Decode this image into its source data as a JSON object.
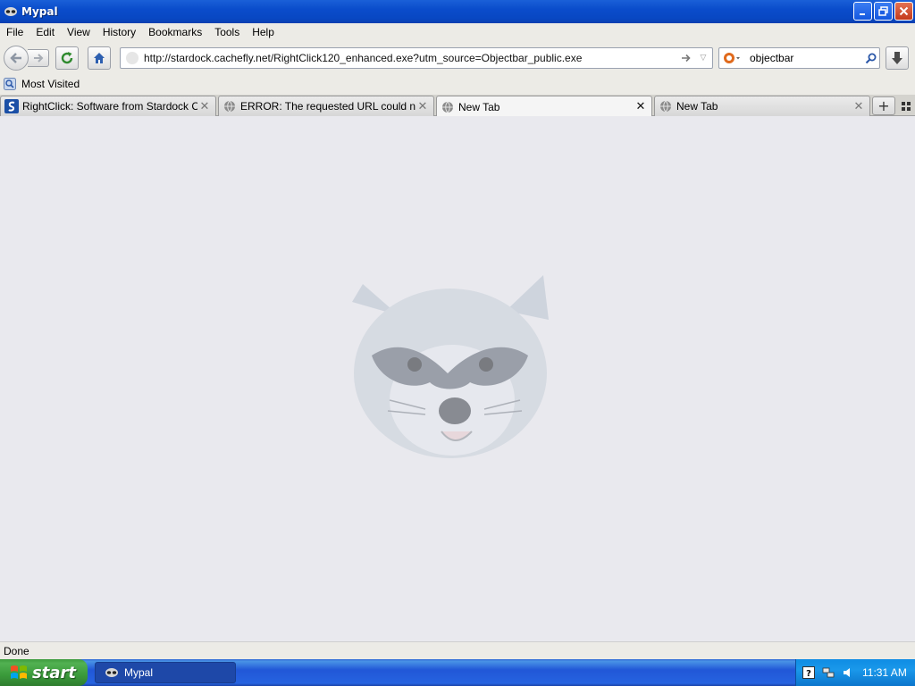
{
  "window": {
    "title": "Mypal"
  },
  "menu": [
    "File",
    "Edit",
    "View",
    "History",
    "Bookmarks",
    "Tools",
    "Help"
  ],
  "nav": {
    "url": "http://stardock.cachefly.net/RightClick120_enhanced.exe?utm_source=Objectbar_public.exe",
    "search_value": "objectbar"
  },
  "bookmarks": {
    "most_visited": "Most Visited"
  },
  "tabs": [
    {
      "label": "RightClick: Software from Stardock Corp...",
      "active": false
    },
    {
      "label": "ERROR: The requested URL could not ...",
      "active": false
    },
    {
      "label": "New Tab",
      "active": true
    },
    {
      "label": "New Tab",
      "active": false
    }
  ],
  "status": {
    "text": "Done"
  },
  "taskbar": {
    "start_label": "start",
    "task_label": "Mypal",
    "clock": "11:31 AM"
  },
  "colors": {
    "title_bar": "#0a4ccb",
    "content_bg": "#e9e9ee",
    "taskbar": "#2157d7",
    "start_green": "#3a9a3a"
  }
}
